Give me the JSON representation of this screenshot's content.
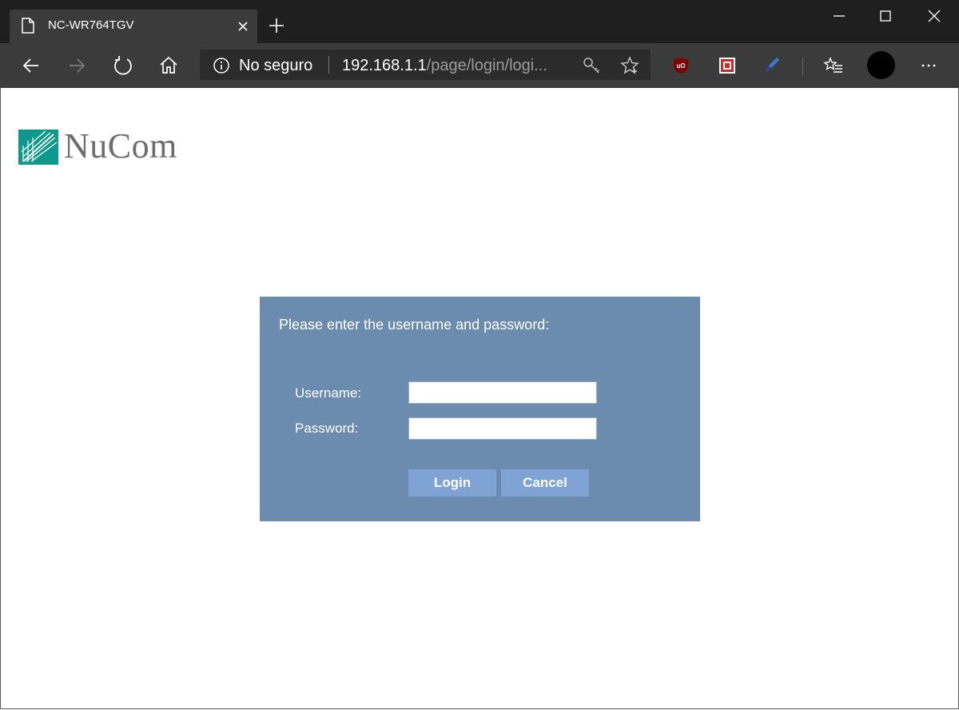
{
  "browser": {
    "tab": {
      "title": "NC-WR764TGV"
    },
    "address_bar": {
      "security_label": "No seguro",
      "url_host": "192.168.1.1",
      "url_path": "/page/login/logi..."
    }
  },
  "icons": {
    "page": "page-icon",
    "close": "close-icon",
    "new_tab": "plus-icon",
    "minimize": "minimize-icon",
    "maximize": "maximize-icon",
    "window_close": "close-icon",
    "back": "arrow-left-icon",
    "forward": "arrow-right-icon",
    "refresh": "refresh-icon",
    "home": "home-icon",
    "info": "info-icon",
    "key": "key-icon",
    "favorite": "star-icon",
    "ublock": "ublock-icon",
    "ext2": "extension-icon",
    "pen": "pen-icon",
    "favorites": "favorites-list-icon",
    "more": "more-icon"
  },
  "colors": {
    "panel": "#6b8cae",
    "button": "#80a3d6",
    "logo_teal": "#0d9a8c",
    "logo_text": "#6d6d6d"
  },
  "logo": {
    "text": "NuCom"
  },
  "login": {
    "prompt": "Please enter the username and password:",
    "username_label": "Username:",
    "password_label": "Password:",
    "username_value": "",
    "password_value": "",
    "login_button": "Login",
    "cancel_button": "Cancel"
  }
}
